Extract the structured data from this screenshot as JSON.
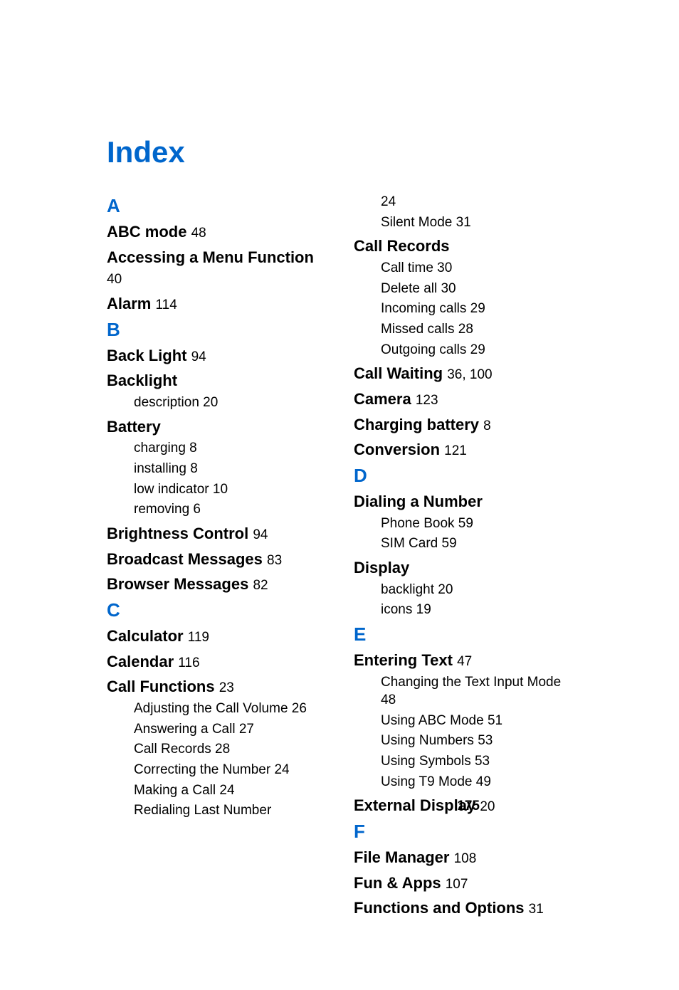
{
  "title": "Index",
  "pageNumber": "175",
  "left": {
    "letters": [
      {
        "letter": "A",
        "entries": [
          {
            "label": "ABC mode",
            "page": "48"
          },
          {
            "label": "Accessing a Menu Function",
            "page": "40"
          },
          {
            "label": "Alarm",
            "page": "114"
          }
        ]
      },
      {
        "letter": "B",
        "entries": [
          {
            "label": "Back Light",
            "page": "94"
          },
          {
            "label": "Backlight",
            "subs": [
              {
                "label": "description",
                "page": "20"
              }
            ]
          },
          {
            "label": "Battery",
            "subs": [
              {
                "label": "charging",
                "page": "8"
              },
              {
                "label": "installing",
                "page": "8"
              },
              {
                "label": "low indicator",
                "page": "10"
              },
              {
                "label": "removing",
                "page": "6"
              }
            ]
          },
          {
            "label": "Brightness Control",
            "page": "94"
          },
          {
            "label": "Broadcast Messages",
            "page": "83"
          },
          {
            "label": "Browser Messages",
            "page": "82"
          }
        ]
      },
      {
        "letter": "C",
        "entries": [
          {
            "label": "Calculator",
            "page": "119"
          },
          {
            "label": "Calendar",
            "page": "116"
          },
          {
            "label": "Call Functions",
            "page": "23",
            "subs": [
              {
                "label": "Adjusting the Call Volume",
                "page": "26"
              },
              {
                "label": "Answering a Call",
                "page": "27"
              },
              {
                "label": "Call Records",
                "page": "28"
              },
              {
                "label": "Correcting the Number",
                "page": "24"
              },
              {
                "label": "Making a Call",
                "page": "24"
              },
              {
                "label": "Redialing Last Number",
                "page": ""
              }
            ]
          }
        ]
      }
    ]
  },
  "right": {
    "preSubs": [
      {
        "label": "",
        "page": "24"
      },
      {
        "label": "Silent Mode",
        "page": "31"
      }
    ],
    "letters": [
      {
        "letter": "",
        "entries": [
          {
            "label": "Call Records",
            "subs": [
              {
                "label": "Call time",
                "page": "30"
              },
              {
                "label": "Delete all",
                "page": "30"
              },
              {
                "label": "Incoming calls",
                "page": "29"
              },
              {
                "label": "Missed calls",
                "page": "28"
              },
              {
                "label": "Outgoing calls",
                "page": "29"
              }
            ]
          },
          {
            "label": "Call Waiting",
            "page": "36, 100"
          },
          {
            "label": "Camera",
            "page": "123"
          },
          {
            "label": "Charging battery",
            "page": "8"
          },
          {
            "label": "Conversion",
            "page": "121"
          }
        ]
      },
      {
        "letter": "D",
        "entries": [
          {
            "label": "Dialing a Number",
            "subs": [
              {
                "label": "Phone Book",
                "page": "59"
              },
              {
                "label": "SIM Card",
                "page": "59"
              }
            ]
          },
          {
            "label": "Display",
            "subs": [
              {
                "label": "backlight",
                "page": "20"
              },
              {
                "label": "icons",
                "page": "19"
              }
            ]
          }
        ]
      },
      {
        "letter": "E",
        "entries": [
          {
            "label": "Entering Text",
            "page": "47",
            "subs": [
              {
                "label": "Changing the Text Input Mode",
                "page": "48"
              },
              {
                "label": "Using ABC Mode",
                "page": "51"
              },
              {
                "label": "Using Numbers",
                "page": "53"
              },
              {
                "label": "Using Symbols",
                "page": "53"
              },
              {
                "label": "Using T9 Mode",
                "page": "49"
              }
            ]
          },
          {
            "label": "External Display",
            "page": "20"
          }
        ]
      },
      {
        "letter": "F",
        "entries": [
          {
            "label": "File Manager",
            "page": "108"
          },
          {
            "label": "Fun & Apps",
            "page": "107"
          },
          {
            "label": "Functions and Options",
            "page": "31"
          }
        ]
      }
    ]
  }
}
